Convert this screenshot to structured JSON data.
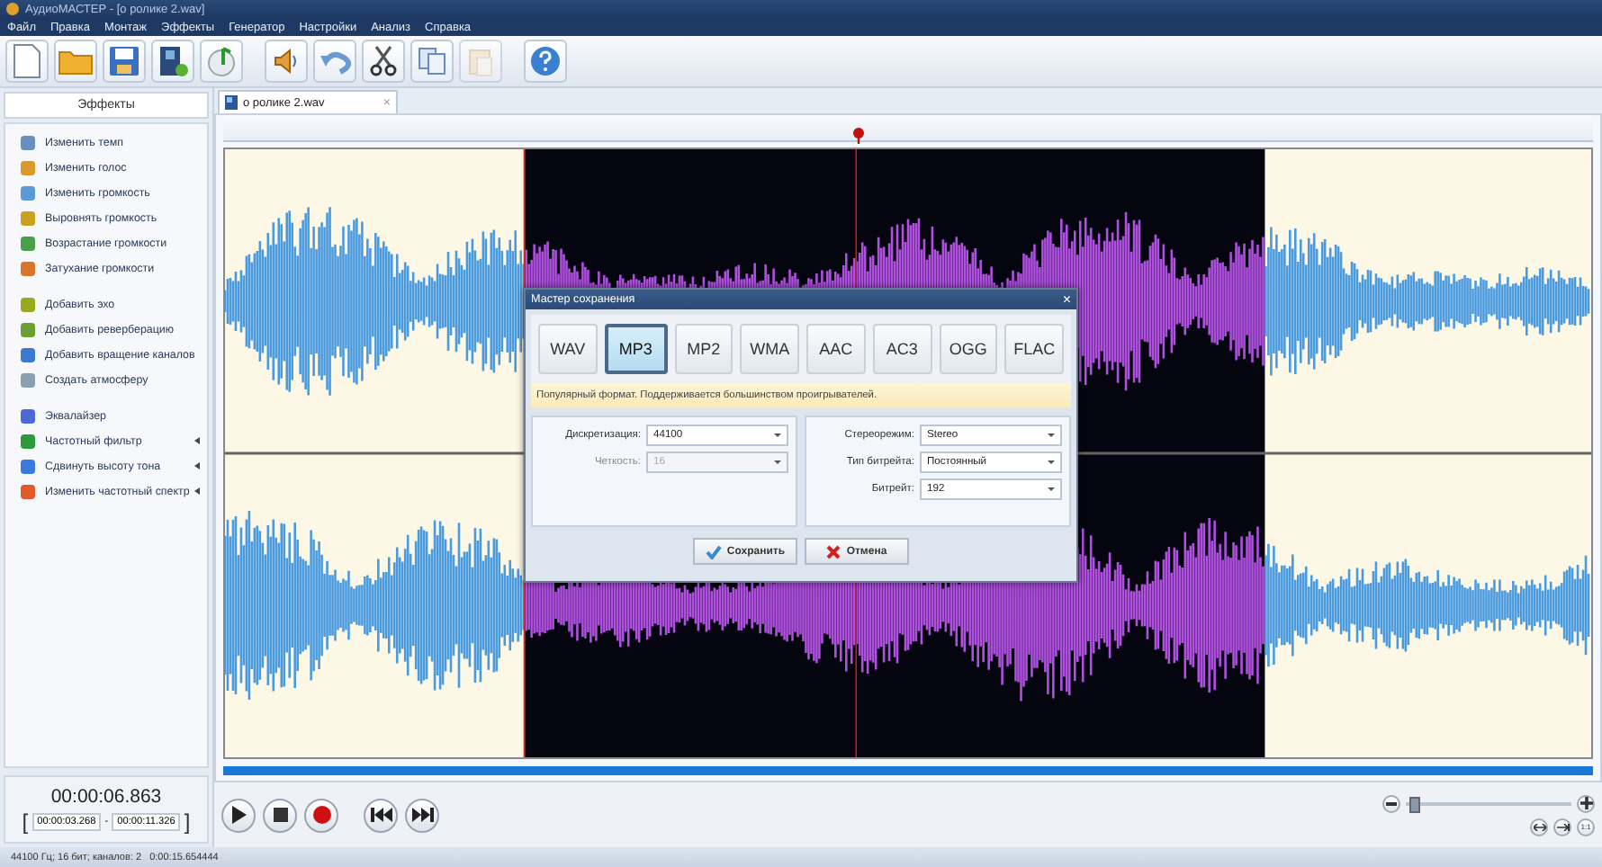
{
  "window": {
    "title": "АудиоМАСТЕР - [о ролике 2.wav]"
  },
  "menu": [
    "Файл",
    "Правка",
    "Монтаж",
    "Эффекты",
    "Генератор",
    "Настройки",
    "Анализ",
    "Справка"
  ],
  "effects_panel": {
    "title": "Эффекты",
    "groups": [
      [
        {
          "label": "Изменить темп",
          "submenu": false
        },
        {
          "label": "Изменить голос",
          "submenu": false
        },
        {
          "label": "Изменить громкость",
          "submenu": false
        },
        {
          "label": "Выровнять громкость",
          "submenu": false
        },
        {
          "label": "Возрастание громкости",
          "submenu": false
        },
        {
          "label": "Затухание громкости",
          "submenu": false
        }
      ],
      [
        {
          "label": "Добавить эхо",
          "submenu": false
        },
        {
          "label": "Добавить реверберацию",
          "submenu": false
        },
        {
          "label": "Добавить вращение каналов",
          "submenu": false
        },
        {
          "label": "Создать атмосферу",
          "submenu": false
        }
      ],
      [
        {
          "label": "Эквалайзер",
          "submenu": false
        },
        {
          "label": "Частотный фильтр",
          "submenu": true
        },
        {
          "label": "Сдвинуть высоту тона",
          "submenu": true
        },
        {
          "label": "Изменить частотный спектр",
          "submenu": true
        }
      ]
    ]
  },
  "file_tab": {
    "label": "о ролике 2.wav",
    "close": "×"
  },
  "save_dialog": {
    "title": "Мастер сохранения",
    "close": "×",
    "formats": [
      {
        "label": "WAV",
        "selected": false
      },
      {
        "label": "MP3",
        "selected": true
      },
      {
        "label": "MP2",
        "selected": false
      },
      {
        "label": "WMA",
        "selected": false
      },
      {
        "label": "AAC",
        "selected": false
      },
      {
        "label": "AC3",
        "selected": false
      },
      {
        "label": "OGG",
        "selected": false
      },
      {
        "label": "FLAC",
        "selected": false
      }
    ],
    "hint": "Популярный формат. Поддерживается большинством проигрывателей.",
    "left_fields": [
      {
        "label": "Дискретизация:",
        "value": "44100",
        "disabled": false
      },
      {
        "label": "Четкость:",
        "value": "16",
        "disabled": true
      }
    ],
    "right_fields": [
      {
        "label": "Стереорежим:",
        "value": "Stereo",
        "disabled": false
      },
      {
        "label": "Тип битрейта:",
        "value": "Постоянный",
        "disabled": false
      },
      {
        "label": "Битрейт:",
        "value": "192",
        "disabled": false
      }
    ],
    "buttons": [
      {
        "label": "Сохранить",
        "kind": "save"
      },
      {
        "label": "Отмена",
        "kind": "cancel"
      }
    ]
  },
  "time": {
    "current": "00:00:06.863",
    "bracket_open": "[",
    "start": "00:00:03.268",
    "separator": "-",
    "end": "00:00:11.326",
    "bracket_close": "]"
  },
  "zoom": {
    "level": 0.02,
    "one_to_one": "1:1"
  },
  "status_bar": "44100 Гц; 16 бит; каналов: 2   0:00:15.654444"
}
